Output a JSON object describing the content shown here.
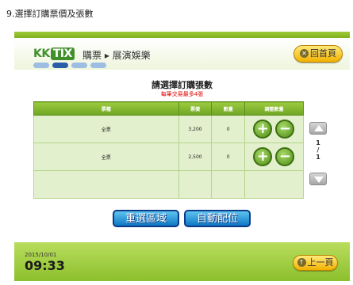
{
  "caption": "9.選擇訂購票價及張數",
  "header": {
    "logo_kk": "KK",
    "logo_tix": "TIX",
    "breadcrumb": "購票 ▸ 展演娛樂",
    "exit_label": "回首頁",
    "exit_icon": "✕"
  },
  "panel": {
    "title": "請選擇訂購張數",
    "subtitle": "每筆交易最多4張"
  },
  "table": {
    "headers": [
      "票種",
      "票價",
      "數量",
      "調整數量"
    ],
    "rows": [
      {
        "name": "全票",
        "price": "3,200",
        "qty": "0"
      },
      {
        "name": "全票",
        "price": "2,500",
        "qty": "0"
      }
    ],
    "plus_symbol": "+",
    "minus_symbol": "−"
  },
  "pager": {
    "current": "1",
    "sep": "/",
    "total": "1"
  },
  "buttons": {
    "reselect": "重選區域",
    "auto_seat": "自動配位"
  },
  "footer": {
    "date": "2015/10/01",
    "time": "09:33",
    "prev_label": "上一頁",
    "prev_icon": "↑"
  },
  "colors": {
    "brand_green": "#8cc02c",
    "button_blue": "#0e78c4",
    "button_yellow": "#f2b100",
    "warning_red": "#e00000"
  }
}
